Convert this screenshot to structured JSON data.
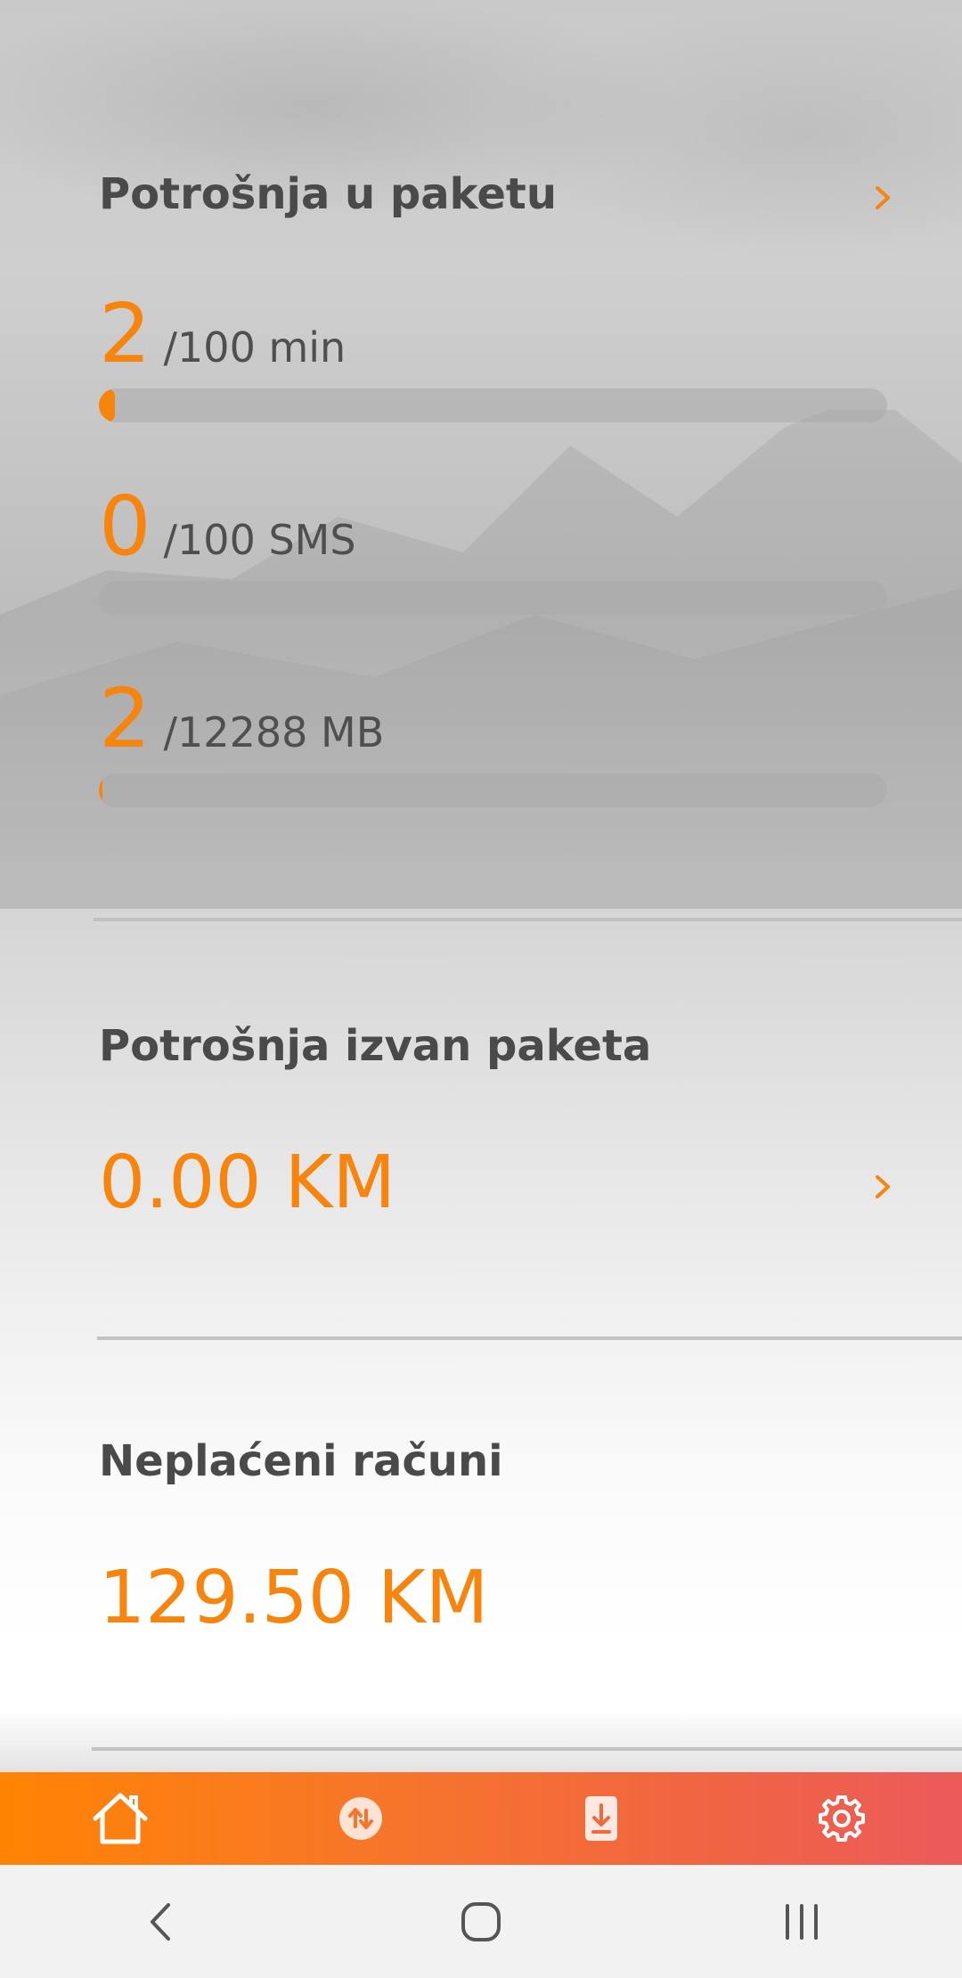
{
  "package_usage": {
    "title": "Potrošnja u paketu",
    "items": [
      {
        "used": "2",
        "total": "/100 min",
        "fraction": 0.02
      },
      {
        "used": "0",
        "total": "/100 SMS",
        "fraction": 0.0
      },
      {
        "used": "2",
        "total": "/12288 MB",
        "fraction": 0.00016
      }
    ]
  },
  "out_of_package": {
    "title": "Potrošnja izvan paketa",
    "amount": "0.00 KM"
  },
  "unpaid_bills": {
    "title": "Neplaćeni računi",
    "amount": "129.50 KM"
  },
  "tabbar": {
    "tabs": [
      {
        "icon": "home-icon"
      },
      {
        "icon": "transfer-icon"
      },
      {
        "icon": "phone-download-icon"
      },
      {
        "icon": "gear-icon"
      }
    ]
  },
  "system_nav": {
    "buttons": [
      "back-icon",
      "home-circle-icon",
      "recents-icon"
    ]
  },
  "colors": {
    "accent": "#f7840d",
    "text": "#4a4a4a",
    "tabbar_start": "#ff8404",
    "tabbar_end": "#ec5a5a"
  }
}
